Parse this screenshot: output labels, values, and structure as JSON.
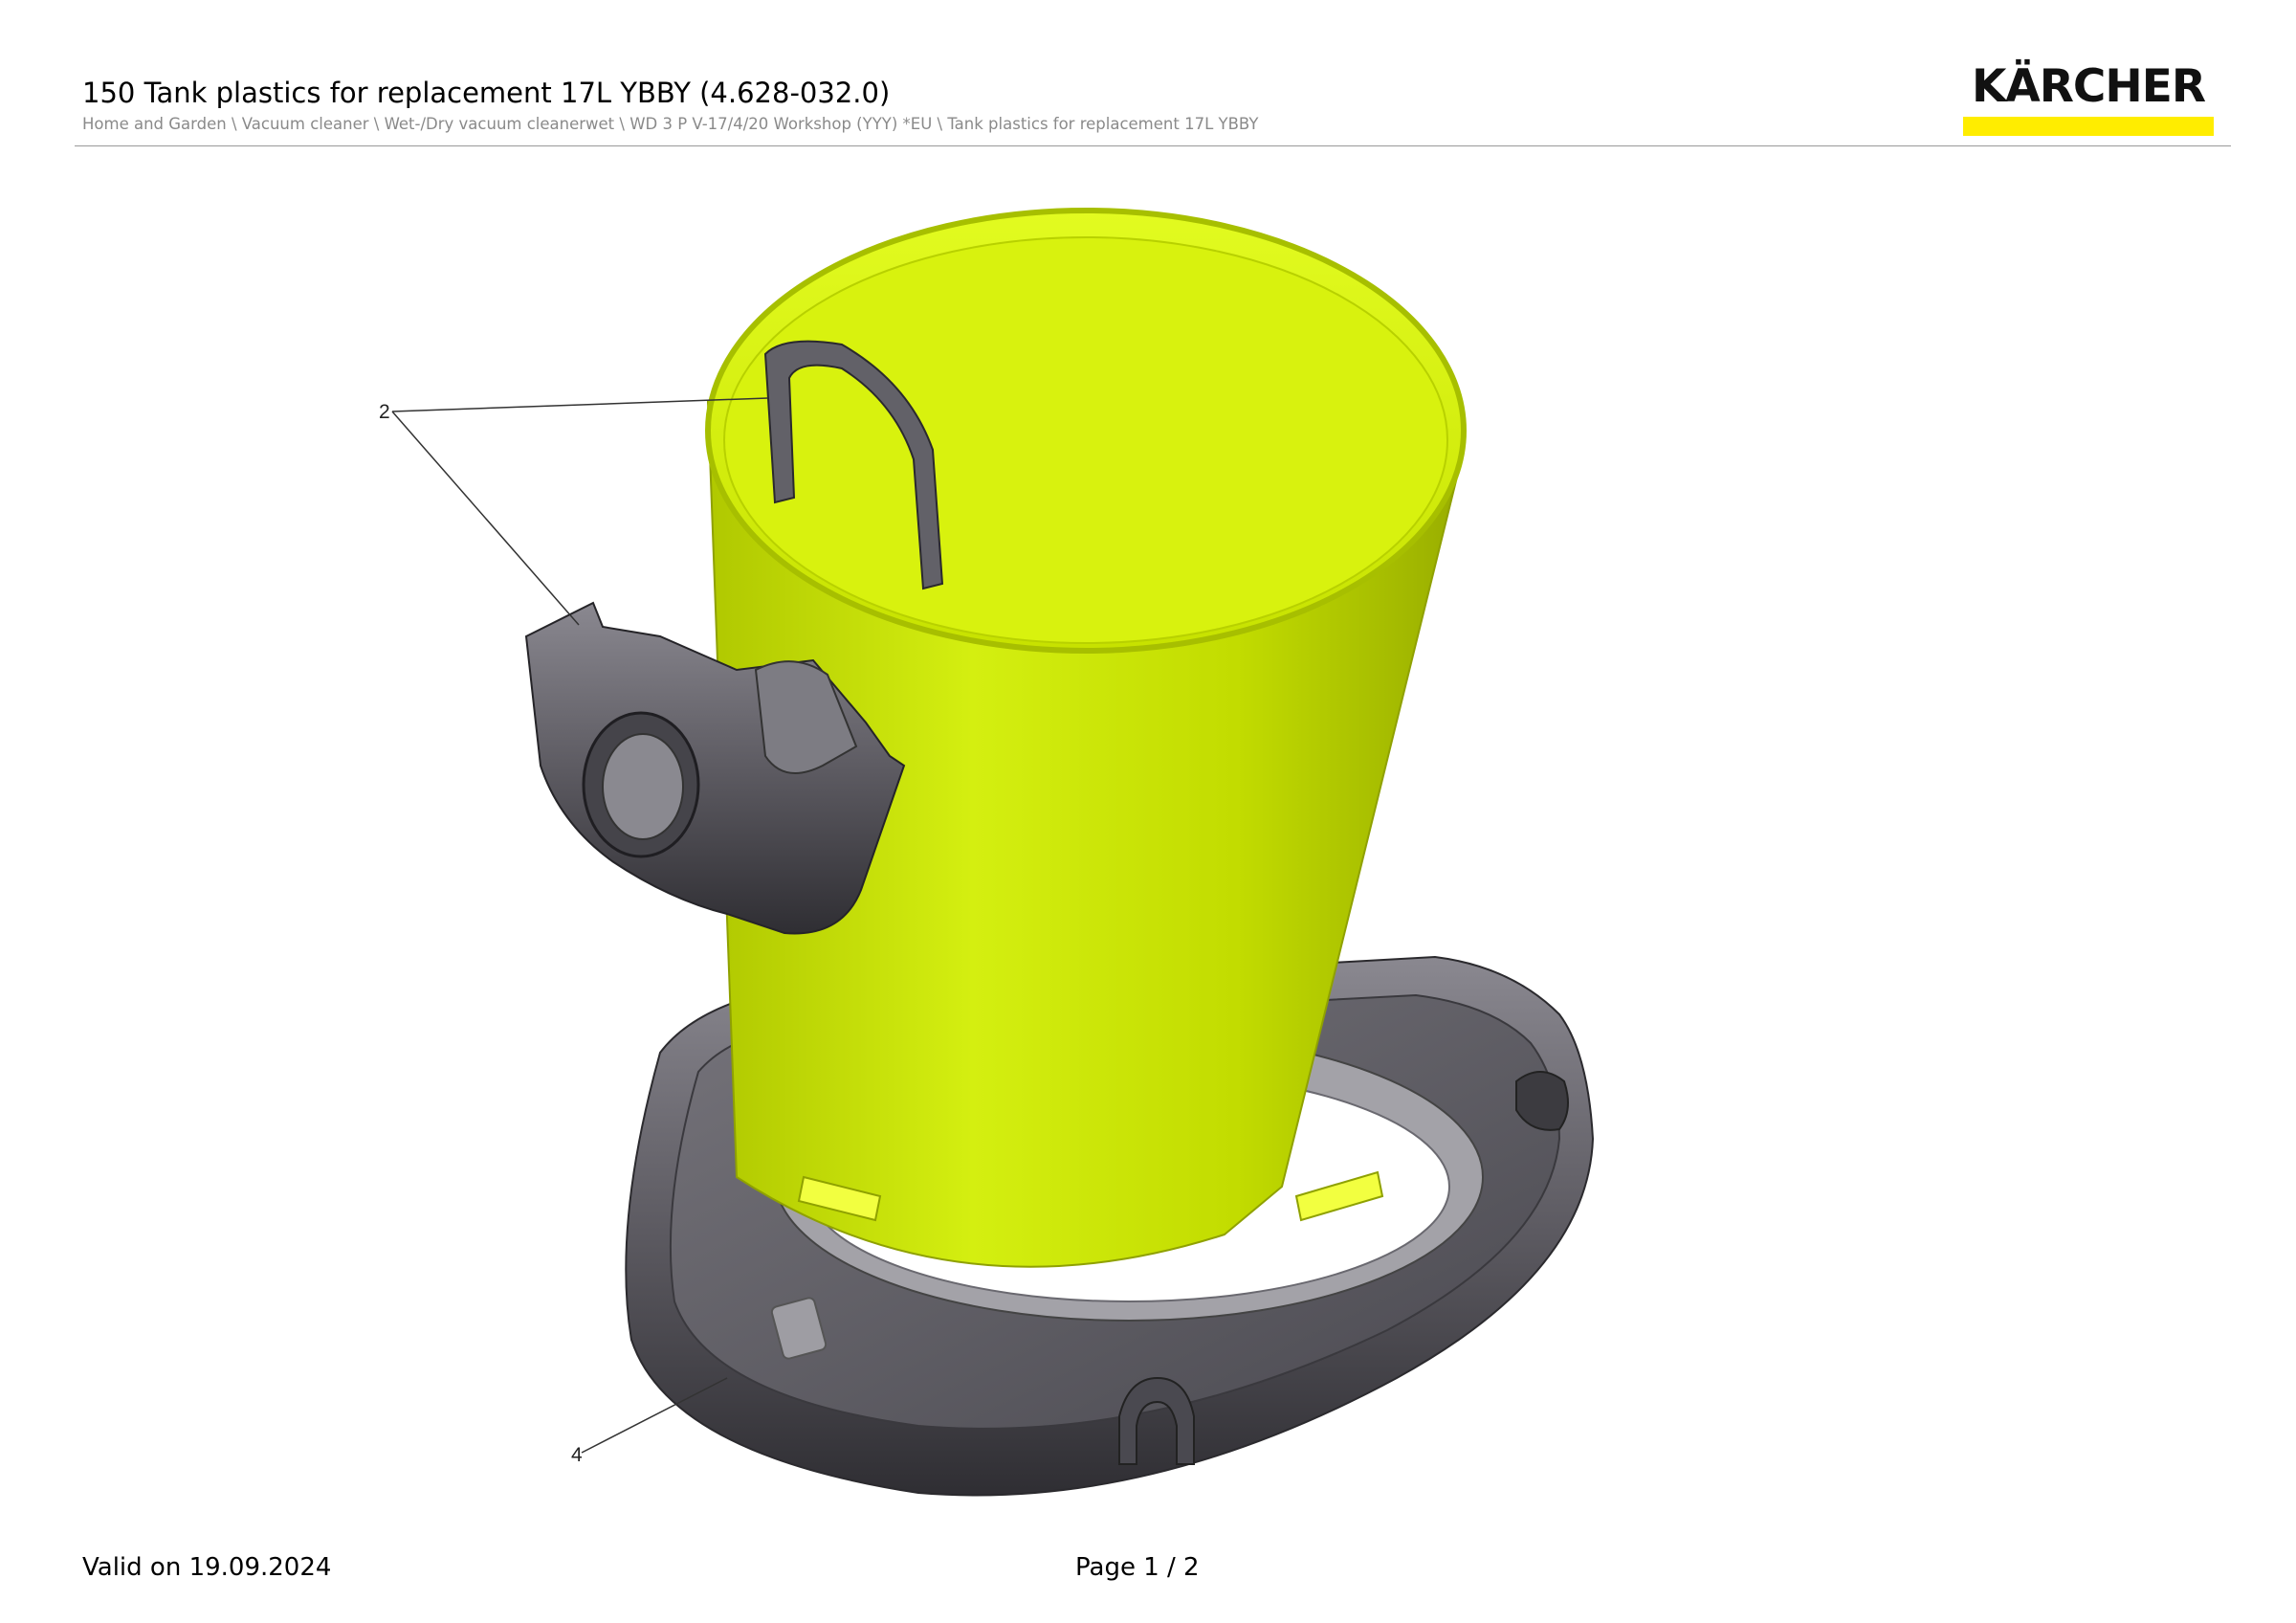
{
  "header": {
    "title": "150 Tank plastics for replacement 17L YBBY (4.628-032.0)",
    "breadcrumb": "Home and Garden \\ Vacuum cleaner \\ Wet-/Dry vacuum cleanerwet \\ WD 3 P V-17/4/20 Workshop (YYY) *EU \\ Tank plastics for replacement 17L YBBY",
    "logo_text": "KÄRCHER"
  },
  "drawing": {
    "callouts": [
      "2",
      "4"
    ]
  },
  "footer": {
    "valid_on": "Valid on 19.09.2024",
    "page": "Page 1 / 2"
  },
  "colors": {
    "brand_yellow": "#ffed00",
    "tank_green": "#c4e000",
    "plastic_gray": "#55535a"
  }
}
